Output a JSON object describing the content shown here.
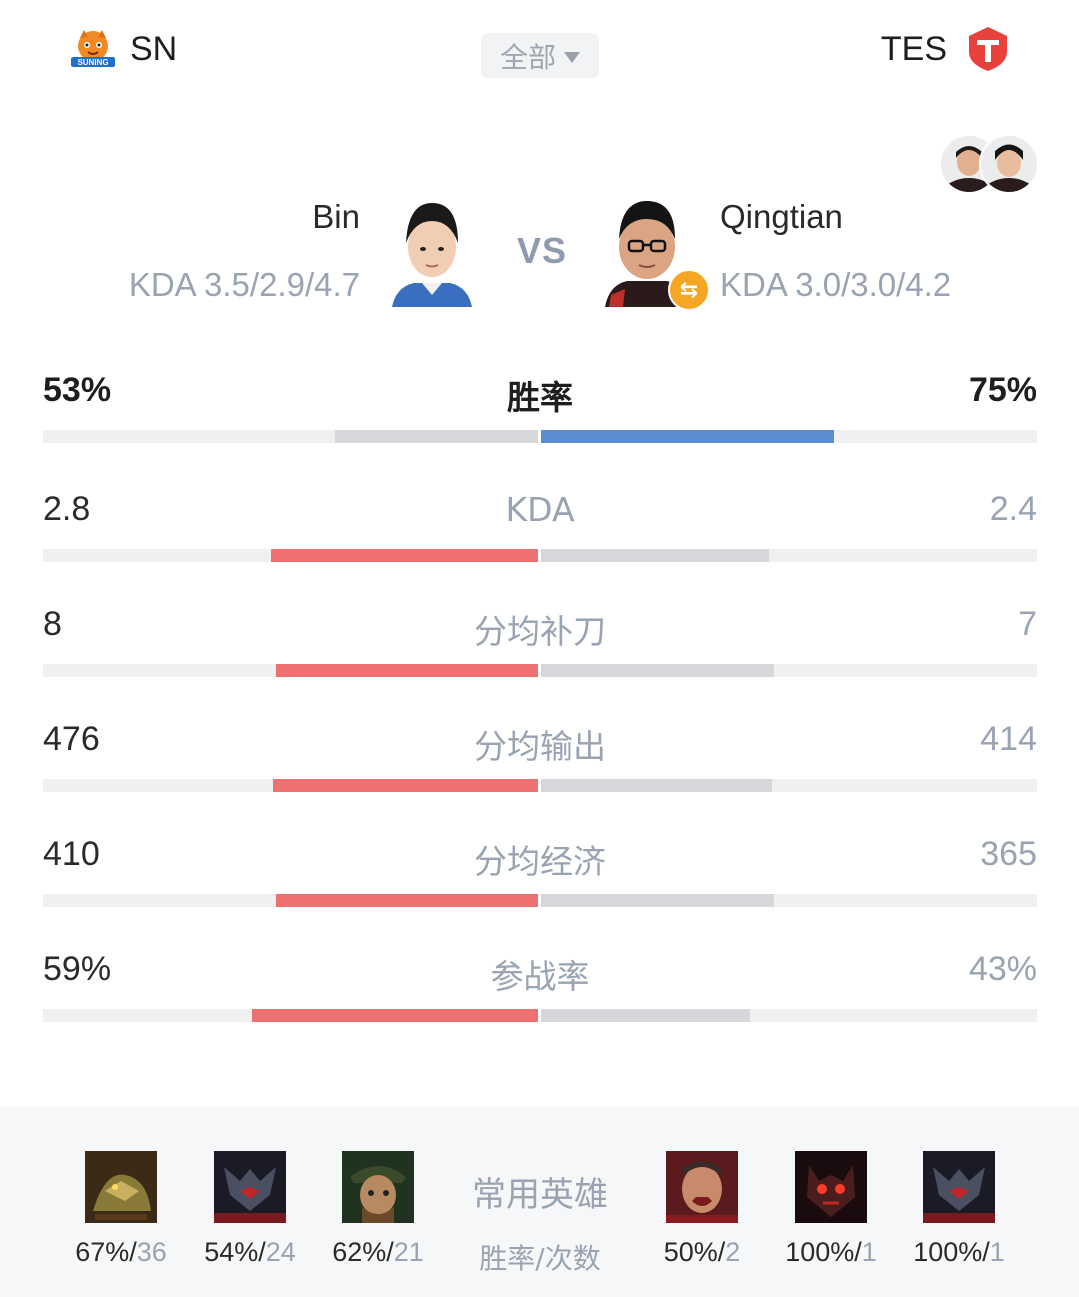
{
  "header": {
    "left_team": "SN",
    "right_team": "TES",
    "filter_label": "全部"
  },
  "left_player": {
    "name": "Bin",
    "kda": "KDA 3.5/2.9/4.7"
  },
  "right_player": {
    "name": "Qingtian",
    "kda": "KDA 3.0/3.0/4.2"
  },
  "vs_label": "VS",
  "colors": {
    "left_accent": "#ef7070",
    "right_accent": "#5b8bd1",
    "neutral_bar": "#d6d7da",
    "track": "#f0f0f0"
  },
  "stats": [
    {
      "label": "胜率",
      "left": "53%",
      "right": "75%",
      "left_fraction": 0.41,
      "right_fraction": 0.59,
      "left_color": "#d6d7da",
      "right_color": "#5b8bd1",
      "bold": true
    },
    {
      "label": "KDA",
      "left": "2.8",
      "right": "2.4",
      "left_fraction": 0.54,
      "right_fraction": 0.46,
      "left_color": "#ef7070",
      "right_color": "#d6d7da",
      "bold": false
    },
    {
      "label": "分均补刀",
      "left": "8",
      "right": "7",
      "left_fraction": 0.53,
      "right_fraction": 0.47,
      "left_color": "#ef7070",
      "right_color": "#d6d7da",
      "bold": false
    },
    {
      "label": "分均输出",
      "left": "476",
      "right": "414",
      "left_fraction": 0.535,
      "right_fraction": 0.465,
      "left_color": "#ef7070",
      "right_color": "#d6d7da",
      "bold": false
    },
    {
      "label": "分均经济",
      "left": "410",
      "right": "365",
      "left_fraction": 0.53,
      "right_fraction": 0.47,
      "left_color": "#ef7070",
      "right_color": "#d6d7da",
      "bold": false
    },
    {
      "label": "参战率",
      "left": "59%",
      "right": "43%",
      "left_fraction": 0.578,
      "right_fraction": 0.422,
      "left_color": "#ef7070",
      "right_color": "#d6d7da",
      "bold": false
    }
  ],
  "heroes": {
    "title": "常用英雄",
    "subtitle": "胜率/次数",
    "left": [
      {
        "icon": "hero-renekton-icon",
        "rate": "67%/",
        "count": "36"
      },
      {
        "icon": "hero-aatrox-icon",
        "rate": "54%/",
        "count": "24"
      },
      {
        "icon": "hero-gangplank-icon",
        "rate": "62%/",
        "count": "21"
      }
    ],
    "right": [
      {
        "icon": "hero-darius-icon",
        "rate": "50%/",
        "count": "2"
      },
      {
        "icon": "hero-ornn-icon",
        "rate": "100%/",
        "count": "1"
      },
      {
        "icon": "hero-aatrox-icon",
        "rate": "100%/",
        "count": "1"
      }
    ]
  }
}
